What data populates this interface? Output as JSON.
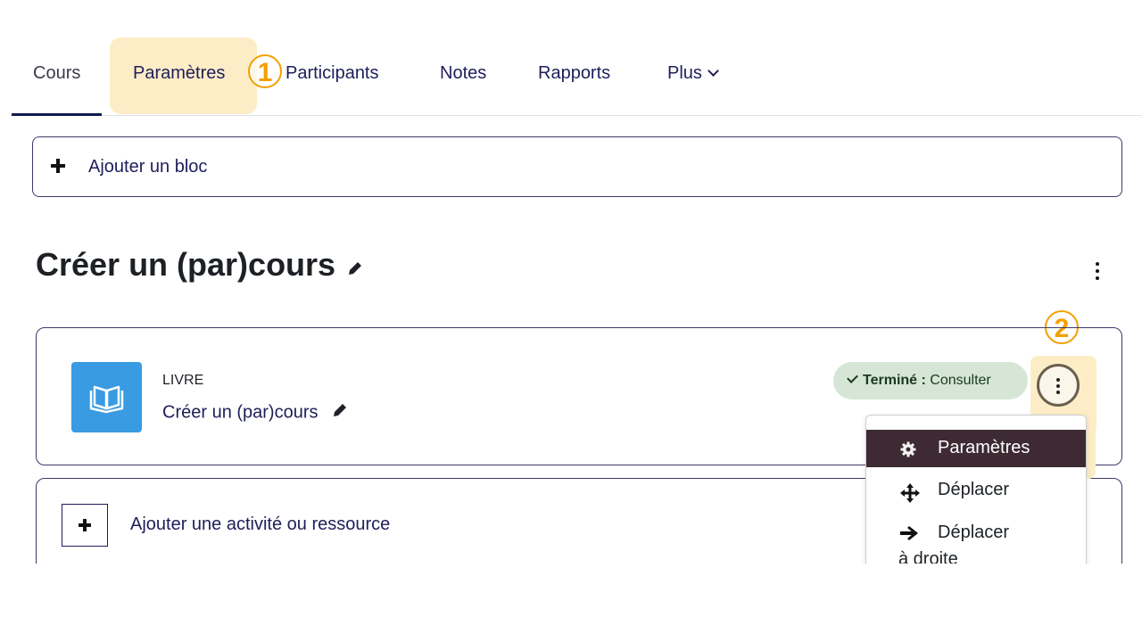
{
  "tabs": {
    "cours": "Cours",
    "parametres": "Paramètres",
    "participants": "Participants",
    "notes": "Notes",
    "rapports": "Rapports",
    "plus": "Plus"
  },
  "callouts": {
    "one": "1",
    "two": "2"
  },
  "add_block": {
    "label": "Ajouter un bloc"
  },
  "section": {
    "title": "Créer un (par)cours"
  },
  "activity": {
    "type": "LIVRE",
    "name": "Créer un (par)cours",
    "badge_status": "Terminé :",
    "badge_action": "Consulter"
  },
  "menu": {
    "settings": "Paramètres",
    "move": "Déplacer",
    "move_right": "Déplacer à droite"
  },
  "add_activity": {
    "label": "Ajouter une activité ou ressource"
  },
  "colors": {
    "highlight": "#fdedc7",
    "callout": "#f2a000",
    "book_icon_bg": "#399be2",
    "badge_bg": "#d5e6d6",
    "menu_selected_bg": "#3d2a33",
    "active_tab_underline": "#0f1a4a"
  },
  "icons": [
    "plus-icon",
    "pencil-icon",
    "kebab-icon",
    "book-icon",
    "check-icon",
    "gear-icon",
    "move-icon",
    "arrow-right-icon",
    "chevron-down-icon"
  ]
}
